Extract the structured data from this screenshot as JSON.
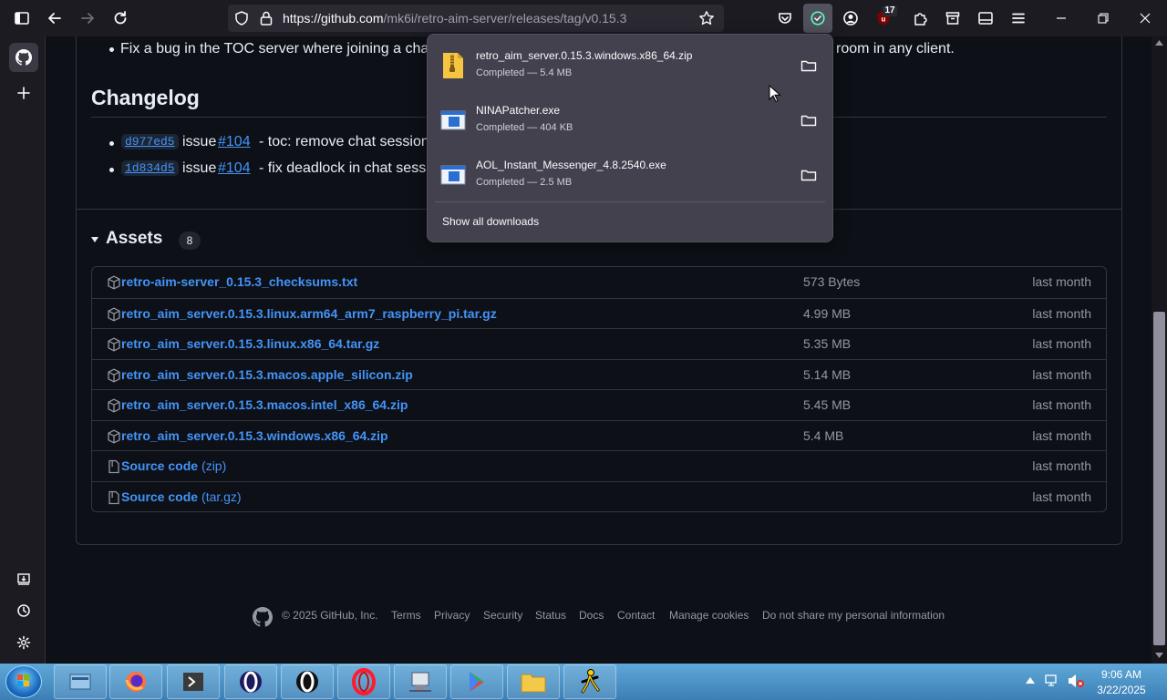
{
  "browser": {
    "url_host": "https://github.com",
    "url_path": "/mk6i/retro-aim-server/releases/tag/v0.15.3",
    "extension_badge": "17"
  },
  "release": {
    "partial_bullet": "Fix a bug in the TOC server where joining a chat",
    "partial_bullet_end": "room in any client.",
    "changelog_heading": "Changelog",
    "changelog": [
      {
        "sha": "d977ed5",
        "issue_word": "issue",
        "issue": "#104",
        "text": "- toc: remove chat sessions"
      },
      {
        "sha": "1d834d5",
        "issue_word": "issue",
        "issue": "#104",
        "text": "- fix deadlock in chat sess r"
      }
    ],
    "assets_heading": "Assets",
    "assets_count": "8",
    "assets": [
      {
        "name": "retro-aim-server_0.15.3_checksums.txt",
        "suffix": "",
        "size": "573 Bytes",
        "date": "last month",
        "icon": "package-icon"
      },
      {
        "name": "retro_aim_server.0.15.3.linux.arm64_arm7_raspberry_pi.tar.gz",
        "suffix": "",
        "size": "4.99 MB",
        "date": "last month",
        "icon": "package-icon"
      },
      {
        "name": "retro_aim_server.0.15.3.linux.x86_64.tar.gz",
        "suffix": "",
        "size": "5.35 MB",
        "date": "last month",
        "icon": "package-icon"
      },
      {
        "name": "retro_aim_server.0.15.3.macos.apple_silicon.zip",
        "suffix": "",
        "size": "5.14 MB",
        "date": "last month",
        "icon": "package-icon"
      },
      {
        "name": "retro_aim_server.0.15.3.macos.intel_x86_64.zip",
        "suffix": "",
        "size": "5.45 MB",
        "date": "last month",
        "icon": "package-icon"
      },
      {
        "name": "retro_aim_server.0.15.3.windows.x86_64.zip",
        "suffix": "",
        "size": "5.4 MB",
        "date": "last month",
        "icon": "package-icon"
      },
      {
        "name": "Source code",
        "suffix": "(zip)",
        "size": "",
        "date": "last month",
        "icon": "file-zip-icon"
      },
      {
        "name": "Source code",
        "suffix": "(tar.gz)",
        "size": "",
        "date": "last month",
        "icon": "file-zip-icon"
      }
    ]
  },
  "footer": {
    "copyright": "© 2025 GitHub, Inc.",
    "links": [
      "Terms",
      "Privacy",
      "Security",
      "Status",
      "Docs",
      "Contact",
      "Manage cookies",
      "Do not share my personal information"
    ]
  },
  "downloads": {
    "items": [
      {
        "name": "retro_aim_server.0.15.3.windows.x86_64.zip",
        "status": "Completed — 5.4 MB",
        "icon": "zip-file-icon"
      },
      {
        "name": "NINAPatcher.exe",
        "status": "Completed — 404 KB",
        "icon": "exe-file-icon"
      },
      {
        "name": "AOL_Instant_Messenger_4.8.2540.exe",
        "status": "Completed — 2.5 MB",
        "icon": "exe-file-icon"
      }
    ],
    "show_all": "Show all downloads"
  },
  "taskbar": {
    "time": "9:06 AM",
    "date": "3/22/2025"
  },
  "colors": {
    "page_bg": "#0d1117",
    "link": "#4493f8",
    "toolbar_bg": "#1c1b22",
    "panel_bg": "#42414d",
    "taskbar": "#3c7fb6"
  }
}
